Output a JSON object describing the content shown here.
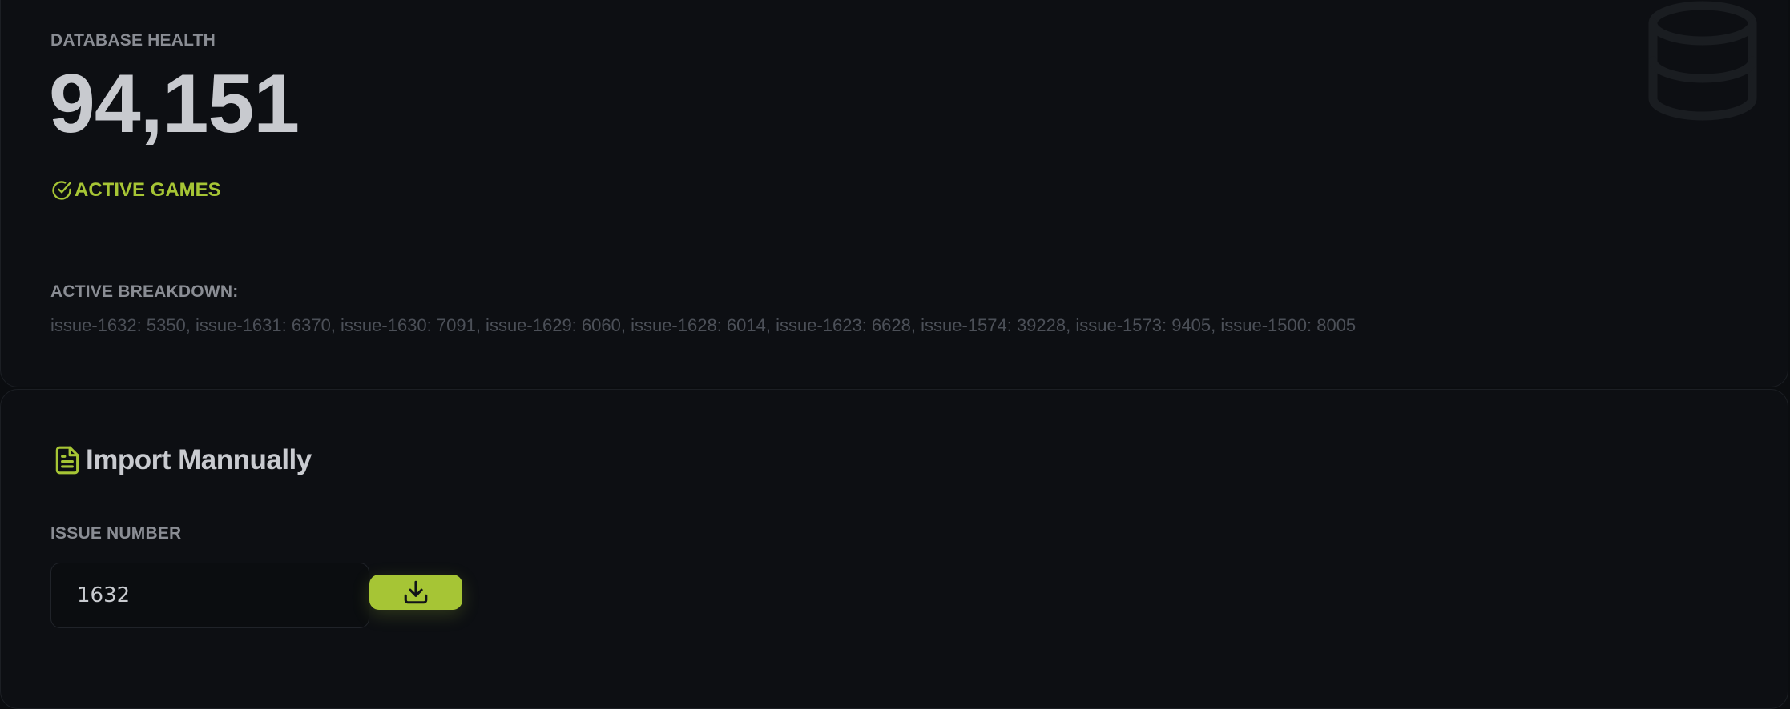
{
  "health": {
    "title": "DATABASE HEALTH",
    "count": "94,151",
    "status_label": "ACTIVE GAMES",
    "breakdown_title": "ACTIVE BREAKDOWN:",
    "breakdown_text": "issue-1632: 5350, issue-1631: 6370, issue-1630: 7091, issue-1629: 6060, issue-1628: 6014, issue-1623: 6628, issue-1574: 39228, issue-1573: 9405, issue-1500: 8005",
    "icon": "database-icon"
  },
  "import": {
    "heading": "Import Mannually",
    "heading_icon": "file-text-icon",
    "issue_label": "ISSUE NUMBER",
    "issue_value": "1632",
    "button_icon": "download-icon"
  },
  "colors": {
    "accent": "#a6c535",
    "background": "#0b0d10",
    "card": "#0d0f13"
  }
}
